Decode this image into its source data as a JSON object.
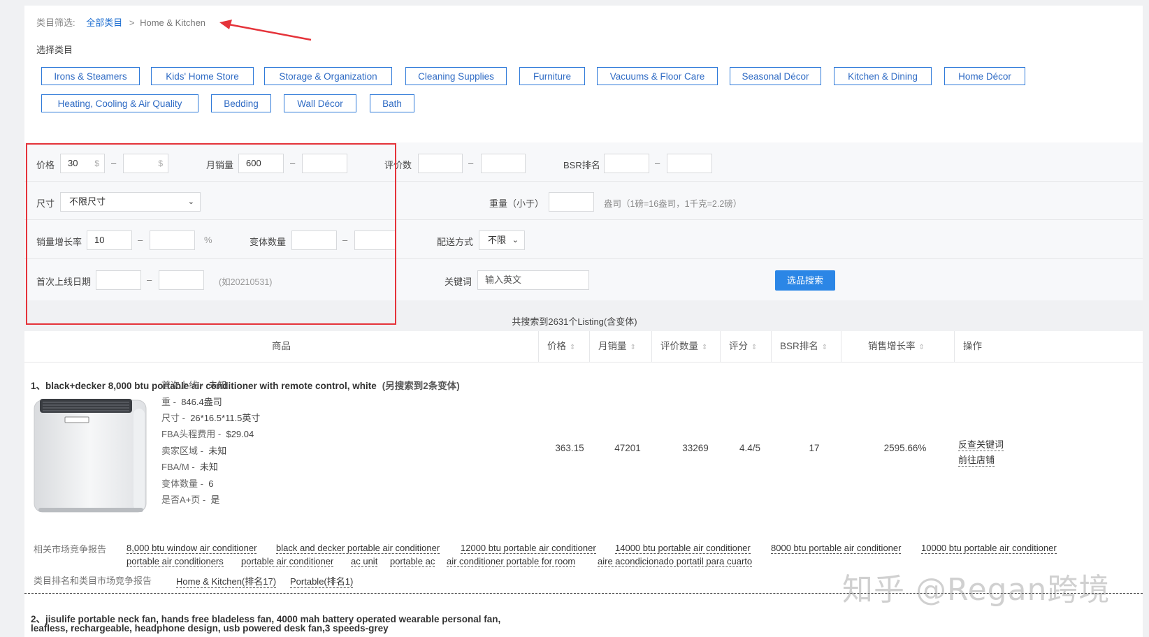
{
  "breadcrumb": {
    "label": "类目筛选:",
    "root": "全部类目",
    "separator": ">",
    "current": "Home & Kitchen"
  },
  "category_section": {
    "label": "选择类目",
    "categories": [
      "Irons & Steamers",
      "Kids' Home Store",
      "Storage & Organization",
      "Cleaning Supplies",
      "Furniture",
      "Vacuums & Floor Care",
      "Seasonal Décor",
      "Kitchen & Dining",
      "Home Décor",
      "Heating, Cooling & Air Quality",
      "Bedding",
      "Wall Décor",
      "Bath"
    ]
  },
  "filters": {
    "price": {
      "label": "价格",
      "min": "30",
      "max": "",
      "unit": "$",
      "dash": "–"
    },
    "monthly_sales": {
      "label": "月销量",
      "min": "600",
      "max": ""
    },
    "reviews": {
      "label": "评价数",
      "min": "",
      "max": ""
    },
    "bsr": {
      "label": "BSR排名",
      "min": "",
      "max": ""
    },
    "size": {
      "label": "尺寸",
      "value": "不限尺寸"
    },
    "weight": {
      "label": "重量（小于）",
      "value": "",
      "hint": "盎司（1磅=16盎司，1千克=2.2磅）"
    },
    "growth": {
      "label": "销量增长率",
      "min": "10",
      "max": "",
      "unit": "%"
    },
    "variants": {
      "label": "变体数量",
      "min": "",
      "max": ""
    },
    "shipping": {
      "label": "配送方式",
      "value": "不限"
    },
    "first_date": {
      "label": "首次上线日期",
      "min": "",
      "max": "",
      "hint": "(如20210531)"
    },
    "keyword": {
      "label": "关键词",
      "placeholder": "输入英文"
    },
    "search_button": "选品搜索"
  },
  "result_count": "共搜索到2631个Listing(含变体)",
  "table": {
    "headers": {
      "product": "商品",
      "price": "价格",
      "sales": "月销量",
      "reviews": "评价数量",
      "rating": "评分",
      "bsr": "BSR排名",
      "growth": "销售增长率",
      "action": "操作"
    },
    "sort_glyph": "⇕",
    "rows": [
      {
        "title": "1、black+decker 8,000 btu portable air conditioner with remote control, white",
        "extra": "(另搜索到2条变体)",
        "details": [
          {
            "k": "首次上线 -",
            "v": "未知"
          },
          {
            "k": "重 -",
            "v": "846.4盎司"
          },
          {
            "k": "尺寸 -",
            "v": "26*16.5*11.5英寸"
          },
          {
            "k": "FBA头程费用 -",
            "v": "$29.04"
          },
          {
            "k": "卖家区域 -",
            "v": "未知"
          },
          {
            "k": "FBA/M -",
            "v": "未知"
          },
          {
            "k": "变体数量 -",
            "v": "6"
          },
          {
            "k": "是否A+页 -",
            "v": "是"
          }
        ],
        "price": "363.15",
        "sales": "47201",
        "reviews": "33269",
        "rating": "4.4/5",
        "bsr": "17",
        "growth": "2595.66%",
        "actions": [
          "反查关键词",
          "前往店铺"
        ],
        "related_label": "相关市场竞争报告",
        "related_keywords": [
          "8,000 btu window air conditioner",
          "black and decker portable air conditioner",
          "12000 btu portable air conditioner",
          "14000 btu portable air conditioner",
          "8000 btu portable air conditioner",
          "10000 btu portable air conditioner",
          "portable air conditioners",
          "portable air conditioner",
          "ac unit",
          "portable ac",
          "air conditioner portable for room",
          "aire acondicionado portatil para cuarto"
        ],
        "category_label": "类目排名和类目市场竞争报告",
        "category_links": [
          "Home & Kitchen(排名17)",
          "Portable(排名1)"
        ]
      },
      {
        "title": "2、jisulife portable neck fan, hands free bladeless fan, 4000 mah battery operated wearable personal fan,",
        "title2": "leafless, rechargeable, headphone design, usb powered desk fan,3 speeds-grey"
      }
    ]
  },
  "watermark": "知乎 @Regan跨境",
  "colors": {
    "accent": "#2b86e6",
    "highlight": "#e5333a"
  }
}
